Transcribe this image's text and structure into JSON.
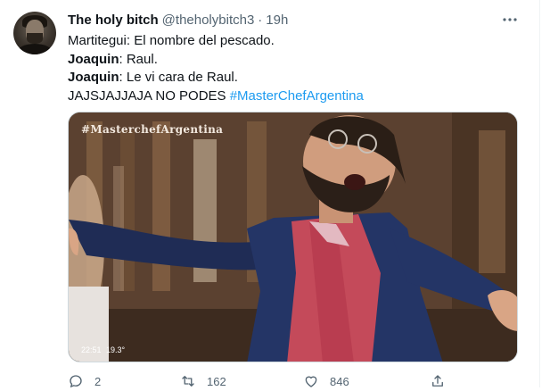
{
  "tweet": {
    "author_name": "The holy bitch",
    "author_handle": "@theholybitch3",
    "separator": "·",
    "time": "19h",
    "lines": [
      {
        "bold": "",
        "text": "Martitegui: El nombre del pescado."
      },
      {
        "bold": "Joaquin",
        "text": ": Raul."
      },
      {
        "bold": "Joaquin",
        "text": ": Le vi cara de Raul."
      }
    ],
    "last_line_text": "JAJSJAJJAJA NO PODES ",
    "hashtag": "#MasterChefArgentina"
  },
  "media": {
    "watermark": "#MasterchefArgentina",
    "overlay_time": "22:51",
    "overlay_temp": "19.3°"
  },
  "actions": {
    "reply_count": "2",
    "retweet_count": "162",
    "like_count": "846"
  },
  "icons": [
    "avatar",
    "more-icon",
    "reply-icon",
    "retweet-icon",
    "like-icon",
    "share-icon"
  ],
  "colors": {
    "accent": "#1d9bf0",
    "secondary_text": "#536471"
  }
}
